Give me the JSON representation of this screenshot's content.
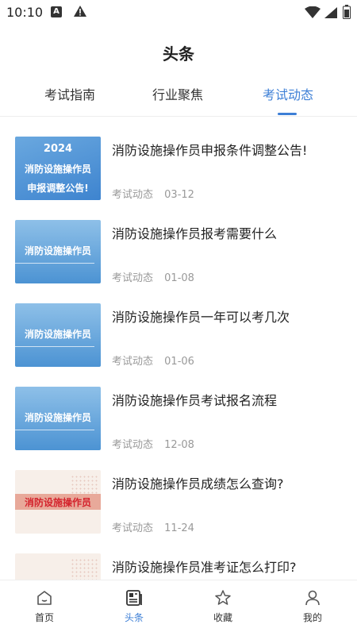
{
  "status": {
    "time": "10:10",
    "a_badge": "A"
  },
  "header": {
    "title": "头条"
  },
  "tabs": [
    {
      "label": "考试指南",
      "active": false
    },
    {
      "label": "行业聚焦",
      "active": false
    },
    {
      "label": "考试动态",
      "active": true
    }
  ],
  "articles": [
    {
      "title": "消防设施操作员申报条件调整公告!",
      "category": "考试动态",
      "date": "03-12",
      "thumbnail": {
        "lines": [
          "2024",
          "消防设施操作员",
          "申报调整公告!"
        ]
      }
    },
    {
      "title": "消防设施操作员报考需要什么",
      "category": "考试动态",
      "date": "01-08",
      "thumbnail": {
        "lines": [
          "消防设施操作员"
        ]
      }
    },
    {
      "title": "消防设施操作员一年可以考几次",
      "category": "考试动态",
      "date": "01-06",
      "thumbnail": {
        "lines": [
          "消防设施操作员"
        ]
      }
    },
    {
      "title": "消防设施操作员考试报名流程",
      "category": "考试动态",
      "date": "12-08",
      "thumbnail": {
        "lines": [
          "消防设施操作员"
        ]
      }
    },
    {
      "title": "消防设施操作员成绩怎么查询?",
      "category": "考试动态",
      "date": "11-24",
      "thumbnail": {
        "lines": [
          "消防设施操作员"
        ]
      }
    },
    {
      "title": "消防设施操作员准考证怎么打印?",
      "category": "",
      "date": "",
      "thumbnail": {
        "lines": []
      }
    }
  ],
  "bottom_nav": [
    {
      "label": "首页",
      "icon": "home-icon",
      "active": false
    },
    {
      "label": "头条",
      "icon": "news-icon",
      "active": true
    },
    {
      "label": "收藏",
      "icon": "star-icon",
      "active": false
    },
    {
      "label": "我的",
      "icon": "user-icon",
      "active": false
    }
  ],
  "colors": {
    "accent": "#3d7fd6",
    "meta_text": "#999999"
  }
}
